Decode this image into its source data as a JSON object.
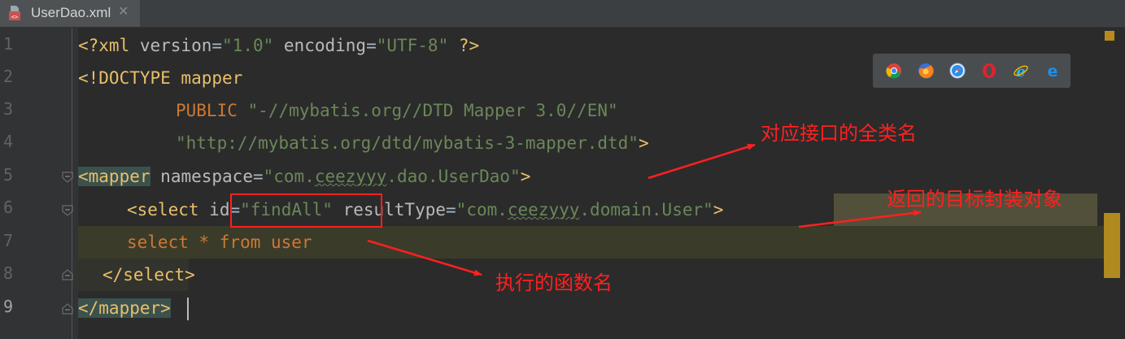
{
  "tab": {
    "filename": "UserDao.xml",
    "close": "✕"
  },
  "gutter": {
    "lines": [
      "1",
      "2",
      "3",
      "4",
      "5",
      "6",
      "7",
      "8",
      "9"
    ]
  },
  "code": {
    "l1": {
      "open": "<?xml ",
      "a1": "version",
      "eq1": "=",
      "v1": "\"1.0\"",
      "sp": " ",
      "a2": "encoding",
      "eq2": "=",
      "v2": "\"UTF-8\"",
      "close": " ?>"
    },
    "l2": {
      "text": "<!DOCTYPE mapper"
    },
    "l3": {
      "kw": "PUBLIC",
      "sp": " ",
      "str": "\"-//mybatis.org//DTD Mapper 3.0//EN\""
    },
    "l4": {
      "str": "\"http://mybatis.org/dtd/mybatis-3-mapper.dtd\"",
      "close": ">"
    },
    "l5": {
      "open": "<mapper",
      "sp": " ",
      "attr": "namespace",
      "eq": "=",
      "val_a": "\"com.",
      "val_b": "ceezyyy",
      "val_c": ".dao.UserDao\"",
      "close": ">"
    },
    "l6": {
      "open": "<select",
      "sp1": " ",
      "a1": "id",
      "eq1": "=",
      "v1": "\"findAll\"",
      "sp2": " ",
      "a2": "resultType",
      "eq2": "=",
      "v2a": "\"com.",
      "v2b": "ceezyyy",
      "v2c": ".domain.User\"",
      "close": ">"
    },
    "l7": {
      "sql": "select * from user"
    },
    "l8": {
      "close": "</select>"
    },
    "l9": {
      "close": "</mapper>"
    }
  },
  "annotations": {
    "interface_name": "对应接口的全类名",
    "return_type": "返回的目标封装对象",
    "method_name": "执行的函数名"
  },
  "browsers": [
    "chrome-icon",
    "firefox-icon",
    "safari-icon",
    "opera-icon",
    "ie-icon",
    "edge-icon"
  ]
}
